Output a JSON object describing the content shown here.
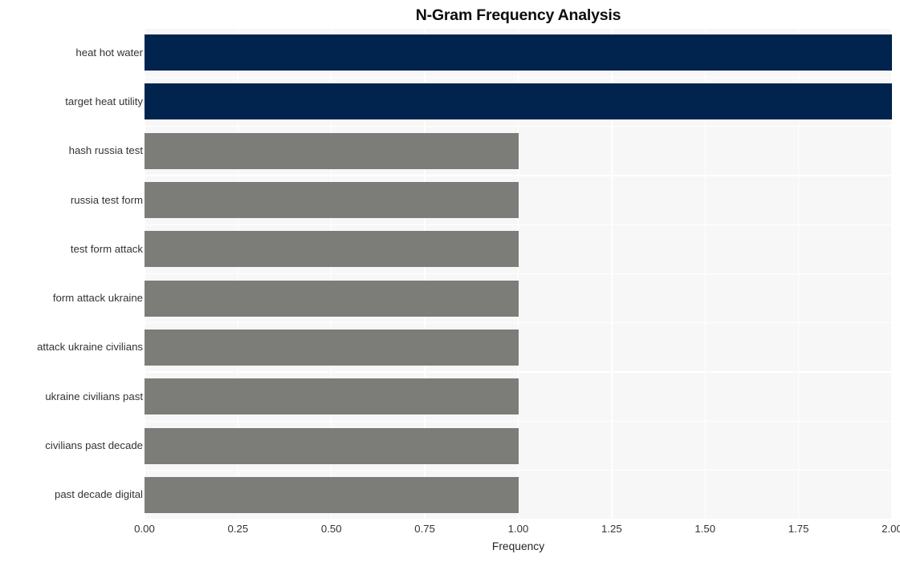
{
  "chart_data": {
    "type": "bar",
    "orientation": "horizontal",
    "title": "N-Gram Frequency Analysis",
    "xlabel": "Frequency",
    "ylabel": "",
    "xlim": [
      0,
      2
    ],
    "grid": true,
    "legend": "none",
    "categories": [
      "heat hot water",
      "target heat utility",
      "hash russia test",
      "russia test form",
      "test form attack",
      "form attack ukraine",
      "attack ukraine civilians",
      "ukraine civilians past",
      "civilians past decade",
      "past decade digital"
    ],
    "values": [
      2,
      2,
      1,
      1,
      1,
      1,
      1,
      1,
      1,
      1
    ],
    "bar_colors": [
      "#00244d",
      "#00244d",
      "#7c7c79",
      "#7c7c79",
      "#7c7c79",
      "#7c7c79",
      "#7c7c79",
      "#7c7c79",
      "#7c7c79",
      "#7c7c79"
    ],
    "xticks": [
      0,
      0.25,
      0.5,
      0.75,
      1,
      1.25,
      1.5,
      1.75,
      2
    ],
    "xtick_labels": [
      "0.00",
      "0.25",
      "0.50",
      "0.75",
      "1.00",
      "1.25",
      "1.50",
      "1.75",
      "2.00"
    ],
    "colors": {
      "plot_background": "#f7f7f8",
      "figure_background": "#ffffff",
      "gridline": "#ffffff",
      "highlight_bar": "#00244d",
      "default_bar": "#7c7c79",
      "tick_text": "#333333",
      "title_text": "#0d0d0d"
    }
  }
}
